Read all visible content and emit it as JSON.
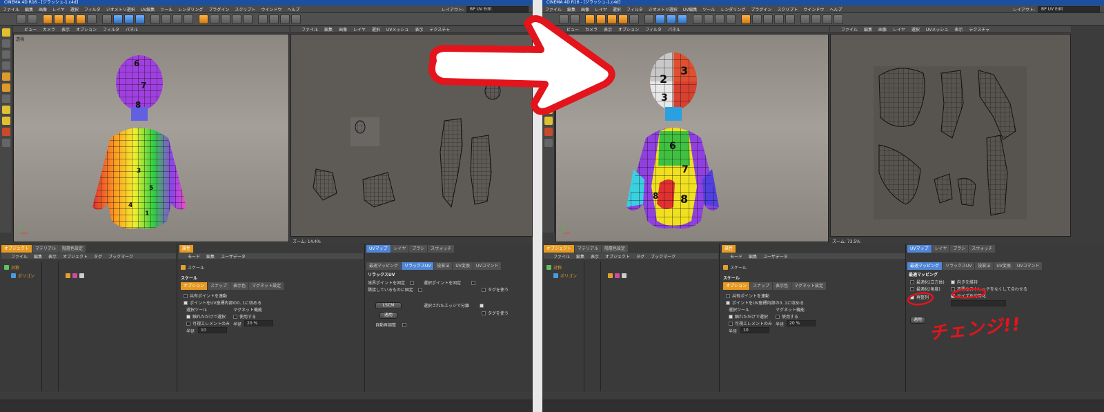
{
  "window": {
    "title_left": "CINEMA 4D R16 - [ジラッシュ-1.c4d]",
    "title_right": "CINEMA 4D R16 - [ジラッシュ-1.c4d]"
  },
  "menu": [
    "ファイル",
    "編集",
    "画像",
    "レイヤ",
    "選択",
    "フィルタ",
    "ジオメトリ選択",
    "UV編集",
    "ツール",
    "レンダリング",
    "プラグイン",
    "スクリプト",
    "ウインドウ",
    "ヘルプ"
  ],
  "layout": {
    "label": "レイアウト:",
    "value": "BP UV Edit"
  },
  "viewport": {
    "menu": [
      "ビュー",
      "カメラ",
      "表示",
      "オプション",
      "フィルタ",
      "パネル"
    ],
    "camera_label": "透視"
  },
  "uv_editor": {
    "menu": [
      "ファイル",
      "編集",
      "画像",
      "レイヤ",
      "選択",
      "UVメッシュ",
      "表示",
      "テクスチャ"
    ],
    "zoom_left": "ズーム: 14.4%",
    "zoom_right": "ズーム: 73.5%"
  },
  "objects_panel": {
    "tabs": [
      "オブジェクト",
      "マテリアル",
      "階層色設定"
    ],
    "menu": [
      "ファイル",
      "編集",
      "表示",
      "オブジェクト",
      "タグ",
      "ブックマーク"
    ],
    "items": [
      "対称",
      "ポリゴン"
    ]
  },
  "attributes_panel": {
    "tab": "属性",
    "menu": [
      "モード",
      "編集",
      "ユーザデータ"
    ],
    "tool_name": "スケール",
    "section": "スケール",
    "subtabs": [
      "オプション",
      "スナップ",
      "表示色",
      "マグネット設定"
    ],
    "options": [
      "共有ポイントを連動",
      "ポイントをUV座標内部の0..1に収める"
    ],
    "group_select": "選択ツール",
    "group_magnet": "マグネット機能",
    "select_opts": [
      "触れただけで選択",
      "可視エレメントのみ"
    ],
    "magnet_use": "使用する",
    "radius_label": "半径",
    "radius_value": "10",
    "magnet_radius_label": "半径",
    "magnet_radius_value": "20 %"
  },
  "uv_left": {
    "tabs": [
      "UVマップ",
      "レイヤ",
      "ブラシ",
      "スウォッチ"
    ],
    "subtabs": [
      "最適マッピング",
      "リラックスUV",
      "投影法",
      "UV変換",
      "UVコマンド"
    ],
    "section": "リラックスUV",
    "pin_border": "境界ポイントを固定",
    "pin_neighbors": "隣接しているものに固定",
    "pin_selected": "選択ポイントを固定",
    "use_tags_1": "タグを使う",
    "method": "LSCM",
    "apply": "適用",
    "auto_realign": "自動再調整",
    "cut_edges": "選択されたエッジで分離",
    "use_tags_2": "タグを使う"
  },
  "uv_right": {
    "tabs": [
      "UVマップ",
      "レイヤ",
      "ブラシ",
      "スウォッチ"
    ],
    "subtabs": [
      "最適マッピング",
      "リラックスUV",
      "投影法",
      "UV変換",
      "UVコマンド"
    ],
    "section": "最適マッピング",
    "opt_cubic": "最適化(立方体)",
    "opt_angle": "最適化(角度)",
    "preserve_orient": "向きを維持",
    "stretch_fit": "不要なストレッチをなくして合わせる",
    "realign": "再整列",
    "equalize": "サイズを均等化",
    "apply": "適用"
  },
  "annotation_text": "チェンジ!!",
  "checker_numbers_left": [
    "6",
    "7",
    "8",
    "3",
    "5",
    "4",
    "1"
  ],
  "checker_numbers_right": [
    "2",
    "3",
    "3",
    "6",
    "7",
    "8",
    "8"
  ],
  "colors": {
    "accent": "#e79a20",
    "blue_tab": "#4f86d8",
    "annotation_red": "#e4141c"
  }
}
